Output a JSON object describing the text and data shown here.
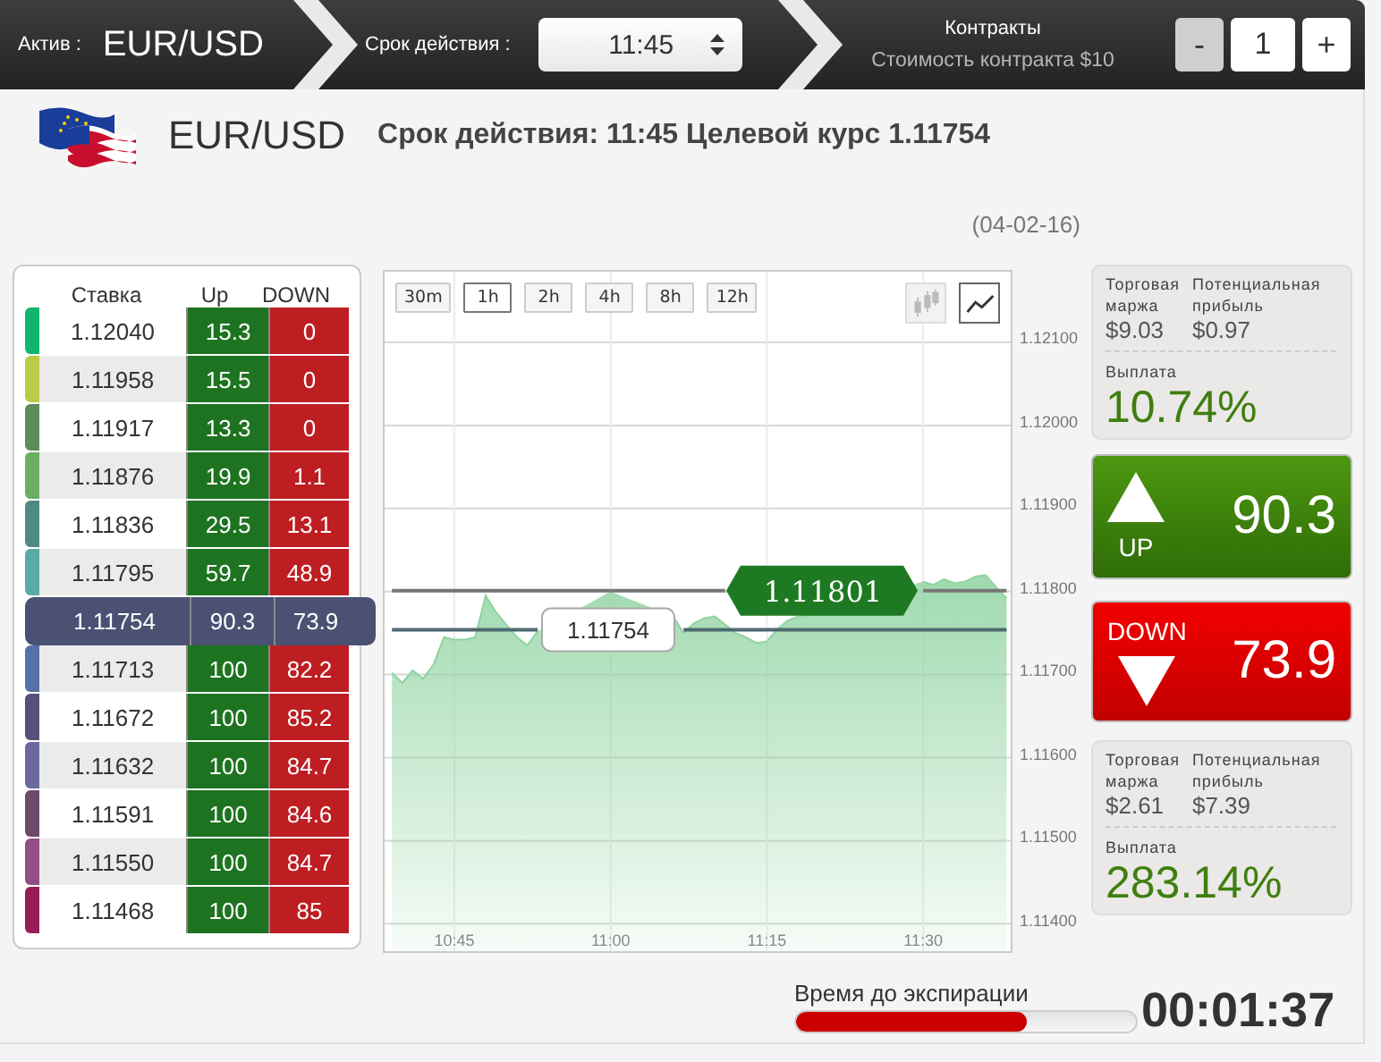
{
  "top_bar": {
    "asset_label": "Актив :",
    "asset": "EUR/USD",
    "expiry_label": "Срок действия :",
    "expiry_value": "11:45",
    "contracts_title": "Контракты",
    "contract_cost": "Стоимость контракта $10",
    "minus": "-",
    "quantity": "1",
    "plus": "+"
  },
  "header": {
    "asset": "EUR/USD",
    "summary": "Срок действия: 11:45 Целевой курс **1.11754**",
    "date": "(04-02-16)"
  },
  "strike_table": {
    "columns": [
      "Ставка",
      "Up",
      "DOWN"
    ],
    "rows": [
      {
        "strike": "1.12040",
        "up": "15.3",
        "down": "0",
        "color": "#12b56e",
        "selected": false
      },
      {
        "strike": "1.11958",
        "up": "15.5",
        "down": "0",
        "color": "#bccb45",
        "selected": false
      },
      {
        "strike": "1.11917",
        "up": "13.3",
        "down": "0",
        "color": "#5e8c5a",
        "selected": false
      },
      {
        "strike": "1.11876",
        "up": "19.9",
        "down": "1.1",
        "color": "#6aaf60",
        "selected": false
      },
      {
        "strike": "1.11836",
        "up": "29.5",
        "down": "13.1",
        "color": "#4e8a80",
        "selected": false
      },
      {
        "strike": "1.11795",
        "up": "59.7",
        "down": "48.9",
        "color": "#5aaaa6",
        "selected": false
      },
      {
        "strike": "1.11754",
        "up": "90.3",
        "down": "73.9",
        "selected": true
      },
      {
        "strike": "1.11713",
        "up": "100",
        "down": "82.2",
        "color": "#5670a8",
        "selected": false
      },
      {
        "strike": "1.11672",
        "up": "100",
        "down": "85.2",
        "color": "#56507a",
        "selected": false
      },
      {
        "strike": "1.11632",
        "up": "100",
        "down": "84.7",
        "color": "#6c6a9c",
        "selected": false
      },
      {
        "strike": "1.11591",
        "up": "100",
        "down": "84.6",
        "color": "#6e4a6a",
        "selected": false
      },
      {
        "strike": "1.11550",
        "up": "100",
        "down": "84.7",
        "color": "#944e86",
        "selected": false
      },
      {
        "strike": "1.11468",
        "up": "100",
        "down": "85",
        "color": "#981c58",
        "selected": false
      }
    ]
  },
  "chart": {
    "periods": [
      {
        "label": "30m",
        "selected": false
      },
      {
        "label": "1h",
        "selected": true
      },
      {
        "label": "2h",
        "selected": false
      },
      {
        "label": "4h",
        "selected": false
      },
      {
        "label": "8h",
        "selected": false
      },
      {
        "label": "12h",
        "selected": false
      }
    ],
    "chart_types": [
      {
        "kind": "candlestick",
        "selected": false
      },
      {
        "kind": "line",
        "selected": true
      }
    ],
    "price_tags": [
      {
        "label": "1.11801"
      },
      {
        "label": "1.11754"
      }
    ],
    "chart_data": {
      "type": "area",
      "categories": [
        null,
        null,
        null,
        null,
        null,
        null,
        "10:45",
        null,
        null,
        null,
        null,
        null,
        null,
        null,
        null,
        null,
        null,
        null,
        null,
        null,
        null,
        "11:00",
        null,
        null,
        null,
        null,
        null,
        null,
        null,
        null,
        null,
        null,
        null,
        null,
        null,
        null,
        "11:15",
        null,
        null,
        null,
        null,
        null,
        null,
        null,
        null,
        null,
        null,
        null,
        null,
        null,
        null,
        "11:30",
        null,
        null,
        null,
        null,
        null,
        null,
        null,
        null
      ],
      "series": [
        {
          "color": "#8fd3a0",
          "values": [
            1.11702,
            1.1169,
            1.11705,
            1.11695,
            1.11712,
            1.11745,
            1.11742,
            1.11742,
            1.11745,
            1.11795,
            1.11775,
            1.1176,
            1.11745,
            1.11735,
            1.11752,
            null,
            null,
            null,
            null,
            null,
            null,
            1.118,
            null,
            null,
            null,
            null,
            null,
            1.1177,
            1.1175,
            1.11762,
            1.11768,
            1.1177,
            1.1176,
            1.1175,
            1.11745,
            1.11738,
            1.1174,
            1.11755,
            1.11765,
            1.1177,
            1.11772,
            null,
            null,
            null,
            null,
            null,
            null,
            null,
            null,
            null,
            null,
            1.11812,
            1.11808,
            1.11815,
            1.1181,
            1.11812,
            1.11818,
            1.1182,
            1.11805,
            1.11792
          ]
        },
        {
          "type": "line",
          "color": "#777777",
          "values": [
            1.11801,
            1.11801,
            1.11801,
            1.11801,
            1.11801,
            1.11801,
            1.11801,
            1.11801,
            1.11801,
            1.11801,
            1.11801,
            1.11801,
            1.11801,
            1.11801,
            1.11801,
            1.11801,
            1.11801,
            1.11801,
            1.11801,
            1.11801,
            1.11801,
            1.11801,
            1.11801,
            1.11801,
            1.11801,
            1.11801,
            1.11801,
            1.11801,
            1.11801,
            1.11801,
            1.11801,
            1.11801,
            1.11801,
            null,
            null,
            null,
            null,
            null,
            null,
            null,
            null,
            null,
            null,
            null,
            null,
            null,
            null,
            null,
            null,
            null,
            null,
            1.11801,
            1.11801,
            1.11801,
            1.11801,
            1.11801,
            1.11801,
            1.11801,
            1.11801,
            1.11801
          ]
        },
        {
          "type": "line",
          "color": "#4f6a72",
          "values": [
            1.11754,
            1.11754,
            1.11754,
            1.11754,
            1.11754,
            1.11754,
            1.11754,
            1.11754,
            1.11754,
            1.11754,
            1.11754,
            1.11754,
            1.11754,
            1.11754,
            1.11754,
            null,
            null,
            null,
            null,
            null,
            null,
            null,
            null,
            null,
            null,
            null,
            null,
            null,
            1.11754,
            1.11754,
            1.11754,
            1.11754,
            1.11754,
            1.11754,
            1.11754,
            1.11754,
            1.11754,
            1.11754,
            1.11754,
            1.11754,
            1.11754,
            1.11754,
            1.11754,
            1.11754,
            1.11754,
            1.11754,
            1.11754,
            1.11754,
            1.11754,
            1.11754,
            1.11754,
            1.11754,
            1.11754,
            1.11754,
            1.11754,
            1.11754,
            1.11754,
            1.11754,
            1.11754,
            1.11754
          ]
        }
      ],
      "ylim": [
        1.11367,
        1.12185
      ],
      "grid": true,
      "yticks": [
        {
          "value": 1.121,
          "label": "1.12100"
        },
        {
          "value": 1.12,
          "label": "1.12000"
        },
        {
          "value": 1.119,
          "label": "1.11900"
        },
        {
          "value": 1.118,
          "label": "1.11800"
        },
        {
          "value": 1.117,
          "label": "1.11700"
        },
        {
          "value": 1.116,
          "label": "1.11600"
        },
        {
          "value": 1.115,
          "label": "1.11500"
        },
        {
          "value": 1.114,
          "label": "1.11400"
        }
      ]
    }
  },
  "up_info": {
    "margin_label": "Торговая маржа",
    "profit_label": "Потенциальная прибыль",
    "margin": "$9.03",
    "profit": "$0.97",
    "payout_label": "Выплата",
    "payout": "10.74%"
  },
  "up_button": {
    "label": "UP",
    "value": "90.3"
  },
  "down_button": {
    "label": "DOWN",
    "value": "73.9"
  },
  "down_info": {
    "margin_label": "Торговая маржа",
    "profit_label": "Потенциальная прибыль",
    "margin": "$2.61",
    "profit": "$7.39",
    "payout_label": "Выплата",
    "payout": "283.14%"
  },
  "expiry": {
    "label": "Время до экспирации",
    "level": 0.68,
    "countdown": "00:01:37"
  }
}
